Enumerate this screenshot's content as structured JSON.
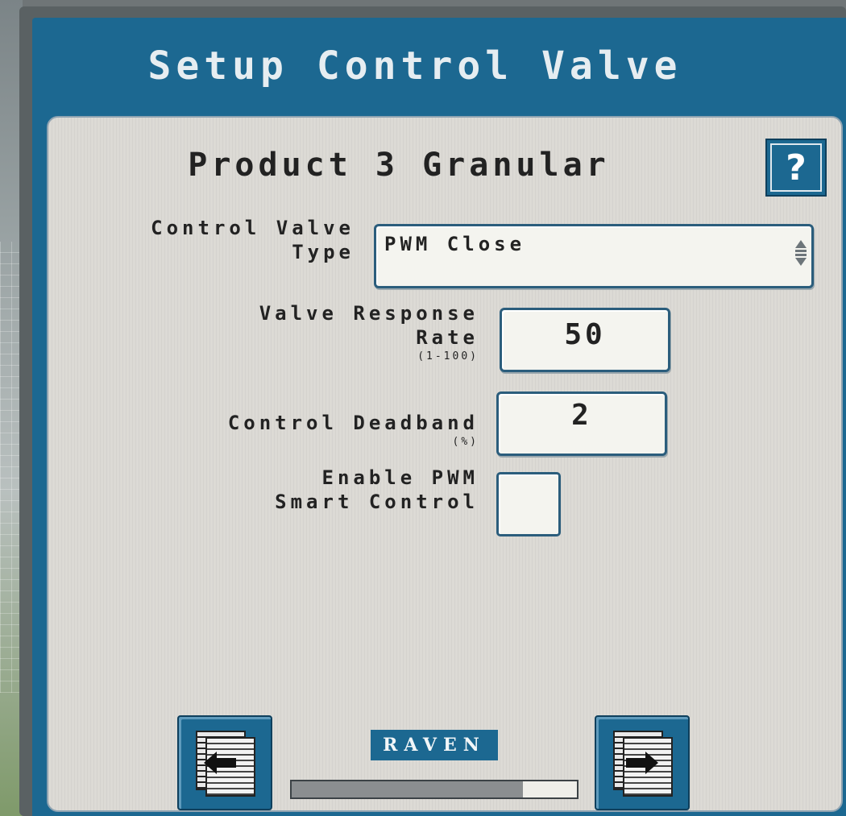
{
  "window": {
    "title": "Setup Control Valve"
  },
  "panel": {
    "heading": "Product 3 Granular",
    "help_label": "?"
  },
  "fields": {
    "valve_type": {
      "label_line1": "Control Valve",
      "label_line2": "Type",
      "value": "PWM Close"
    },
    "response_rate": {
      "label_line1": "Valve Response",
      "label_line2": "Rate",
      "hint": "(1-100)",
      "value": "50"
    },
    "deadband": {
      "label": "Control Deadband",
      "hint": "(%)",
      "value": "2"
    },
    "pwm_smart": {
      "label_line1": "Enable PWM",
      "label_line2": "Smart Control",
      "checked": false
    }
  },
  "footer": {
    "brand": "RAVEN",
    "progress_fraction": 0.81,
    "back_icon": "page-back-icon",
    "next_icon": "page-next-icon"
  },
  "colors": {
    "accent": "#1c6891",
    "panel": "#dcdad5"
  }
}
